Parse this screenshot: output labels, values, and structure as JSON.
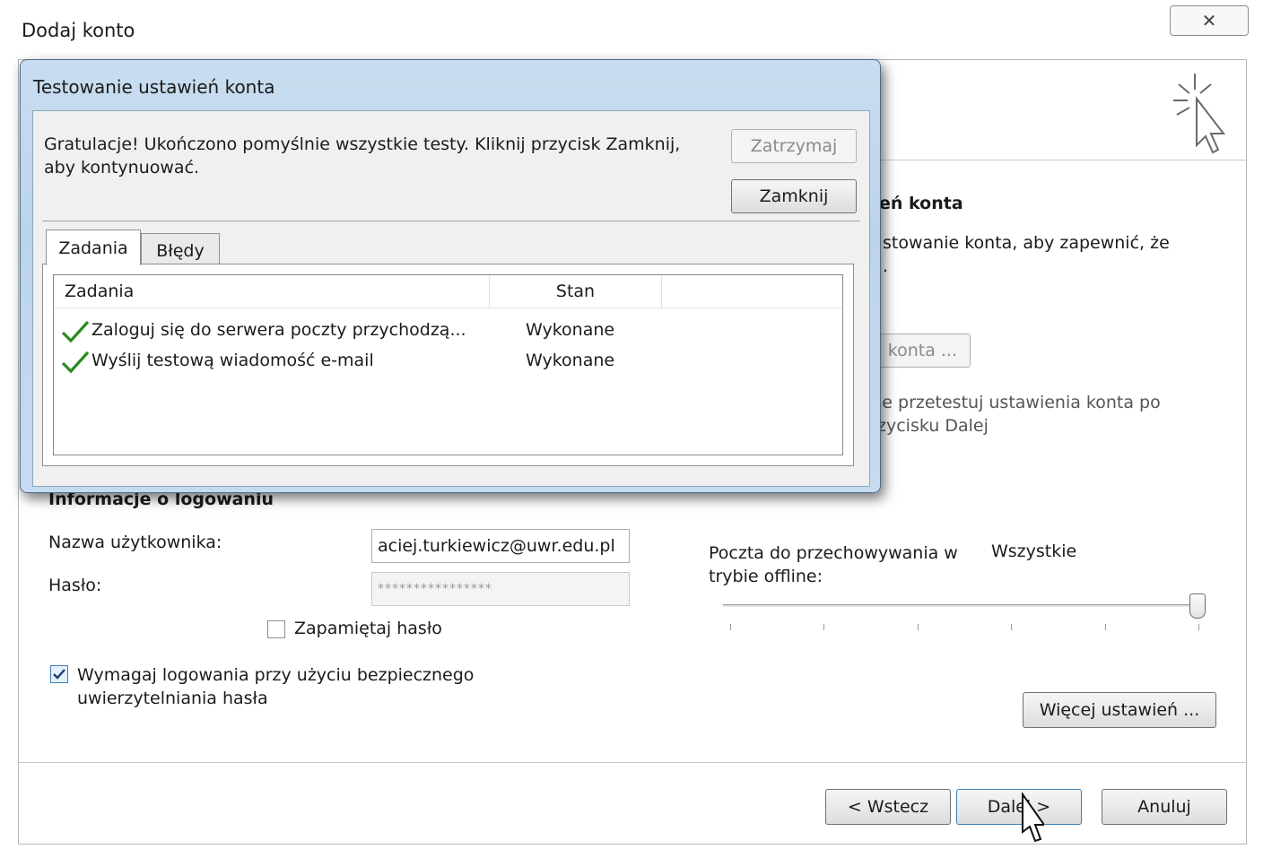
{
  "window": {
    "title": "Dodaj konto",
    "close_glyph": "✕"
  },
  "main": {
    "section_fragment": "eń konta",
    "description_fragment_1": "stowanie konta, aby zapewnić, że",
    "description_fragment_2": ".",
    "test_button_fragment": "konta ...",
    "auto_test_fragment_1": "ie przetestuj ustawienia konta po",
    "auto_test_fragment_2": "zycisku Dalej"
  },
  "login": {
    "heading": "Informacje o logowaniu",
    "username_label": "Nazwa użytkownika:",
    "username_value": "aciej.turkiewicz@uwr.edu.pl",
    "password_label": "Hasło:",
    "password_value": "****************",
    "remember_label": "Zapamiętaj hasło",
    "remember_checked": false,
    "spa_label_line1": "Wymagaj logowania przy użyciu bezpiecznego",
    "spa_label_line2": "uwierzytelniania hasła",
    "spa_checked": true
  },
  "offline": {
    "label_line1": "Poczta do przechowywania w",
    "label_line2": "trybie offline:",
    "value": "Wszystkie",
    "slider_level": 1.0,
    "tick_count": 6
  },
  "more_settings_button": "Więcej ustawień ...",
  "footer": {
    "back_button": "< Wstecz",
    "next_button": "Dalej >",
    "cancel_button": "Anuluj"
  },
  "modal": {
    "title": "Testowanie ustawień konta",
    "message_line1": "Gratulacje! Ukończono pomyślnie wszystkie testy. Kliknij przycisk Zamknij,",
    "message_line2": "aby kontynuować.",
    "stop_button": "Zatrzymaj",
    "close_button": "Zamknij",
    "tabs": [
      {
        "label": "Zadania",
        "active": true
      },
      {
        "label": "Błędy",
        "active": false
      }
    ],
    "columns": [
      "Zadania",
      "Stan",
      ""
    ],
    "rows": [
      {
        "task": "Zaloguj się do serwera poczty przychodzą...",
        "status": "Wykonane",
        "icon": "check-icon"
      },
      {
        "task": "Wyślij testową wiadomość e-mail",
        "status": "Wykonane",
        "icon": "check-icon"
      }
    ]
  },
  "colors": {
    "modal_frame": "#bcd4ea",
    "check_green": "#2a8a1f"
  }
}
